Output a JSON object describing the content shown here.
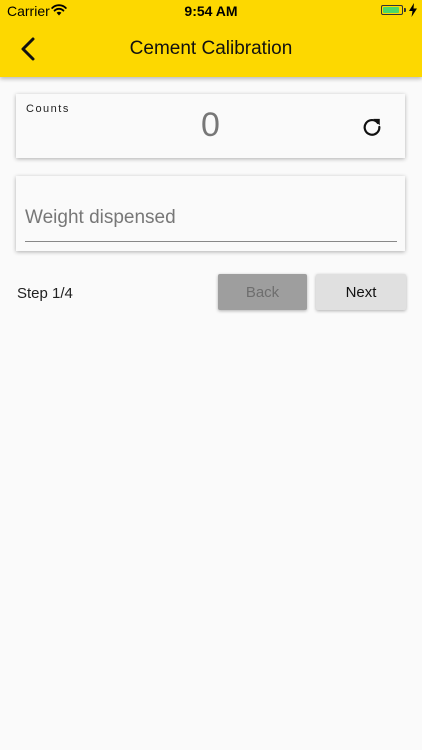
{
  "status_bar": {
    "carrier": "Carrier",
    "time": "9:54 AM",
    "battery_level_percent": 90,
    "battery_color": "#4cd964"
  },
  "header": {
    "title": "Cement Calibration",
    "back_icon": "chevron-left-icon",
    "background_color": "#fdd800"
  },
  "counts": {
    "label": "Counts",
    "value": "0",
    "refresh_icon": "refresh-icon"
  },
  "weight_field": {
    "value": "",
    "placeholder": "Weight dispensed"
  },
  "footer": {
    "step_text": "Step 1/4",
    "back_label": "Back",
    "next_label": "Next"
  }
}
